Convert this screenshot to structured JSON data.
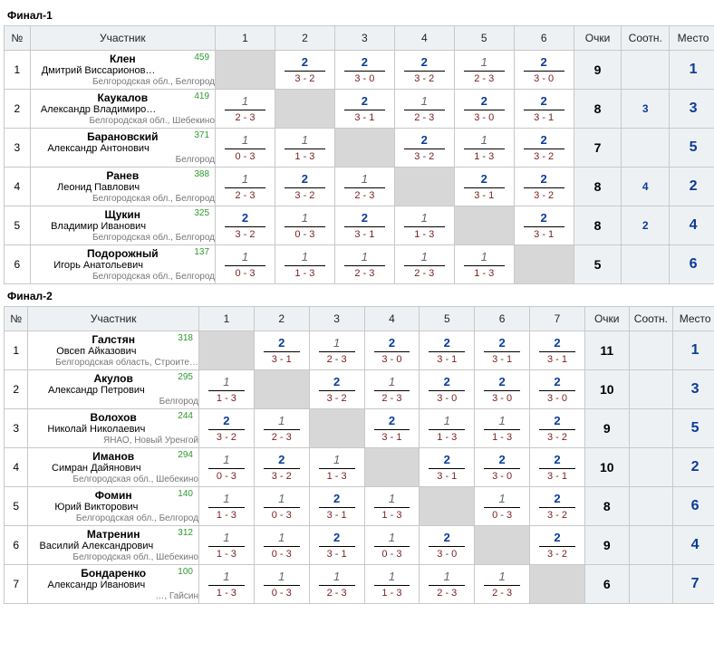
{
  "headers": {
    "num": "№",
    "participant": "Участник",
    "points": "Очки",
    "sootn": "Соотн.",
    "place": "Место"
  },
  "groups": [
    {
      "title": "Финал-1",
      "size": 6,
      "rows": [
        {
          "num": 1,
          "surname": "Клен",
          "name": "Дмитрий Виссарионов…",
          "region": "Белгородская обл., Белгород",
          "rating": 459,
          "cells": [
            null,
            {
              "t": "2",
              "w": true,
              "b": "3 - 2"
            },
            {
              "t": "2",
              "w": true,
              "b": "3 - 0"
            },
            {
              "t": "2",
              "w": true,
              "b": "3 - 2"
            },
            {
              "t": "1",
              "w": false,
              "b": "2 - 3"
            },
            {
              "t": "2",
              "w": true,
              "b": "3 - 0"
            }
          ],
          "points": "9",
          "sootn": "",
          "place": "1"
        },
        {
          "num": 2,
          "surname": "Каукалов",
          "name": "Александр Владимиро…",
          "region": "Белгородская обл., Шебекино",
          "rating": 419,
          "cells": [
            {
              "t": "1",
              "w": false,
              "b": "2 - 3"
            },
            null,
            {
              "t": "2",
              "w": true,
              "b": "3 - 1"
            },
            {
              "t": "1",
              "w": false,
              "b": "2 - 3"
            },
            {
              "t": "2",
              "w": true,
              "b": "3 - 0"
            },
            {
              "t": "2",
              "w": true,
              "b": "3 - 1"
            }
          ],
          "points": "8",
          "sootn": "3",
          "place": "3"
        },
        {
          "num": 3,
          "surname": "Барановский",
          "name": "Александр Антонович",
          "region": "Белгород",
          "rating": 371,
          "cells": [
            {
              "t": "1",
              "w": false,
              "b": "0 - 3"
            },
            {
              "t": "1",
              "w": false,
              "b": "1 - 3"
            },
            null,
            {
              "t": "2",
              "w": true,
              "b": "3 - 2"
            },
            {
              "t": "1",
              "w": false,
              "b": "1 - 3"
            },
            {
              "t": "2",
              "w": true,
              "b": "3 - 2"
            }
          ],
          "points": "7",
          "sootn": "",
          "place": "5"
        },
        {
          "num": 4,
          "surname": "Ранев",
          "name": "Леонид Павлович",
          "region": "Белгородская обл., Белгород",
          "rating": 388,
          "cells": [
            {
              "t": "1",
              "w": false,
              "b": "2 - 3"
            },
            {
              "t": "2",
              "w": true,
              "b": "3 - 2"
            },
            {
              "t": "1",
              "w": false,
              "b": "2 - 3"
            },
            null,
            {
              "t": "2",
              "w": true,
              "b": "3 - 1"
            },
            {
              "t": "2",
              "w": true,
              "b": "3 - 2"
            }
          ],
          "points": "8",
          "sootn": "4",
          "place": "2"
        },
        {
          "num": 5,
          "surname": "Щукин",
          "name": "Владимир Иванович",
          "region": "Белгородская обл., Белгород",
          "rating": 325,
          "cells": [
            {
              "t": "2",
              "w": true,
              "b": "3 - 2"
            },
            {
              "t": "1",
              "w": false,
              "b": "0 - 3"
            },
            {
              "t": "2",
              "w": true,
              "b": "3 - 1"
            },
            {
              "t": "1",
              "w": false,
              "b": "1 - 3"
            },
            null,
            {
              "t": "2",
              "w": true,
              "b": "3 - 1"
            }
          ],
          "points": "8",
          "sootn": "2",
          "place": "4"
        },
        {
          "num": 6,
          "surname": "Подорожный",
          "name": "Игорь Анатольевич",
          "region": "Белгородская обл., Белгород",
          "rating": 137,
          "cells": [
            {
              "t": "1",
              "w": false,
              "b": "0 - 3"
            },
            {
              "t": "1",
              "w": false,
              "b": "1 - 3"
            },
            {
              "t": "1",
              "w": false,
              "b": "2 - 3"
            },
            {
              "t": "1",
              "w": false,
              "b": "2 - 3"
            },
            {
              "t": "1",
              "w": false,
              "b": "1 - 3"
            },
            null
          ],
          "points": "5",
          "sootn": "",
          "place": "6"
        }
      ]
    },
    {
      "title": "Финал-2",
      "size": 7,
      "rows": [
        {
          "num": 1,
          "surname": "Галстян",
          "name": "Овсеп Айказович",
          "region": "Белгородская область, Строите…",
          "rating": 318,
          "cells": [
            null,
            {
              "t": "2",
              "w": true,
              "b": "3 - 1"
            },
            {
              "t": "1",
              "w": false,
              "b": "2 - 3"
            },
            {
              "t": "2",
              "w": true,
              "b": "3 - 0"
            },
            {
              "t": "2",
              "w": true,
              "b": "3 - 1"
            },
            {
              "t": "2",
              "w": true,
              "b": "3 - 1"
            },
            {
              "t": "2",
              "w": true,
              "b": "3 - 1"
            }
          ],
          "points": "11",
          "sootn": "",
          "place": "1"
        },
        {
          "num": 2,
          "surname": "Акулов",
          "name": "Александр Петрович",
          "region": "Белгород",
          "rating": 295,
          "cells": [
            {
              "t": "1",
              "w": false,
              "b": "1 - 3"
            },
            null,
            {
              "t": "2",
              "w": true,
              "b": "3 - 2"
            },
            {
              "t": "1",
              "w": false,
              "b": "2 - 3"
            },
            {
              "t": "2",
              "w": true,
              "b": "3 - 0"
            },
            {
              "t": "2",
              "w": true,
              "b": "3 - 0"
            },
            {
              "t": "2",
              "w": true,
              "b": "3 - 0"
            }
          ],
          "points": "10",
          "sootn": "",
          "place": "3"
        },
        {
          "num": 3,
          "surname": "Волохов",
          "name": "Николай Николаевич",
          "region": "ЯНАО, Новый Уренгой",
          "rating": 244,
          "cells": [
            {
              "t": "2",
              "w": true,
              "b": "3 - 2"
            },
            {
              "t": "1",
              "w": false,
              "b": "2 - 3"
            },
            null,
            {
              "t": "2",
              "w": true,
              "b": "3 - 1"
            },
            {
              "t": "1",
              "w": false,
              "b": "1 - 3"
            },
            {
              "t": "1",
              "w": false,
              "b": "1 - 3"
            },
            {
              "t": "2",
              "w": true,
              "b": "3 - 2"
            }
          ],
          "points": "9",
          "sootn": "",
          "place": "5"
        },
        {
          "num": 4,
          "surname": "Иманов",
          "name": "Симран Дайянович",
          "region": "Белгородская обл., Шебекино",
          "rating": 294,
          "cells": [
            {
              "t": "1",
              "w": false,
              "b": "0 - 3"
            },
            {
              "t": "2",
              "w": true,
              "b": "3 - 2"
            },
            {
              "t": "1",
              "w": false,
              "b": "1 - 3"
            },
            null,
            {
              "t": "2",
              "w": true,
              "b": "3 - 1"
            },
            {
              "t": "2",
              "w": true,
              "b": "3 - 0"
            },
            {
              "t": "2",
              "w": true,
              "b": "3 - 1"
            }
          ],
          "points": "10",
          "sootn": "",
          "place": "2"
        },
        {
          "num": 5,
          "surname": "Фомин",
          "name": "Юрий Викторович",
          "region": "Белгородская обл., Белгород",
          "rating": 140,
          "cells": [
            {
              "t": "1",
              "w": false,
              "b": "1 - 3"
            },
            {
              "t": "1",
              "w": false,
              "b": "0 - 3"
            },
            {
              "t": "2",
              "w": true,
              "b": "3 - 1"
            },
            {
              "t": "1",
              "w": false,
              "b": "1 - 3"
            },
            null,
            {
              "t": "1",
              "w": false,
              "b": "0 - 3"
            },
            {
              "t": "2",
              "w": true,
              "b": "3 - 2"
            }
          ],
          "points": "8",
          "sootn": "",
          "place": "6"
        },
        {
          "num": 6,
          "surname": "Матренин",
          "name": "Василий Александрович",
          "region": "Белгородская обл., Шебекино",
          "rating": 312,
          "cells": [
            {
              "t": "1",
              "w": false,
              "b": "1 - 3"
            },
            {
              "t": "1",
              "w": false,
              "b": "0 - 3"
            },
            {
              "t": "2",
              "w": true,
              "b": "3 - 1"
            },
            {
              "t": "1",
              "w": false,
              "b": "0 - 3"
            },
            {
              "t": "2",
              "w": true,
              "b": "3 - 0"
            },
            null,
            {
              "t": "2",
              "w": true,
              "b": "3 - 2"
            }
          ],
          "points": "9",
          "sootn": "",
          "place": "4"
        },
        {
          "num": 7,
          "surname": "Бондаренко",
          "name": "Александр Иванович",
          "region": "…, Гайсин",
          "rating": 100,
          "cells": [
            {
              "t": "1",
              "w": false,
              "b": "1 - 3"
            },
            {
              "t": "1",
              "w": false,
              "b": "0 - 3"
            },
            {
              "t": "1",
              "w": false,
              "b": "2 - 3"
            },
            {
              "t": "1",
              "w": false,
              "b": "1 - 3"
            },
            {
              "t": "1",
              "w": false,
              "b": "2 - 3"
            },
            {
              "t": "1",
              "w": false,
              "b": "2 - 3"
            },
            null
          ],
          "points": "6",
          "sootn": "",
          "place": "7"
        }
      ]
    }
  ]
}
